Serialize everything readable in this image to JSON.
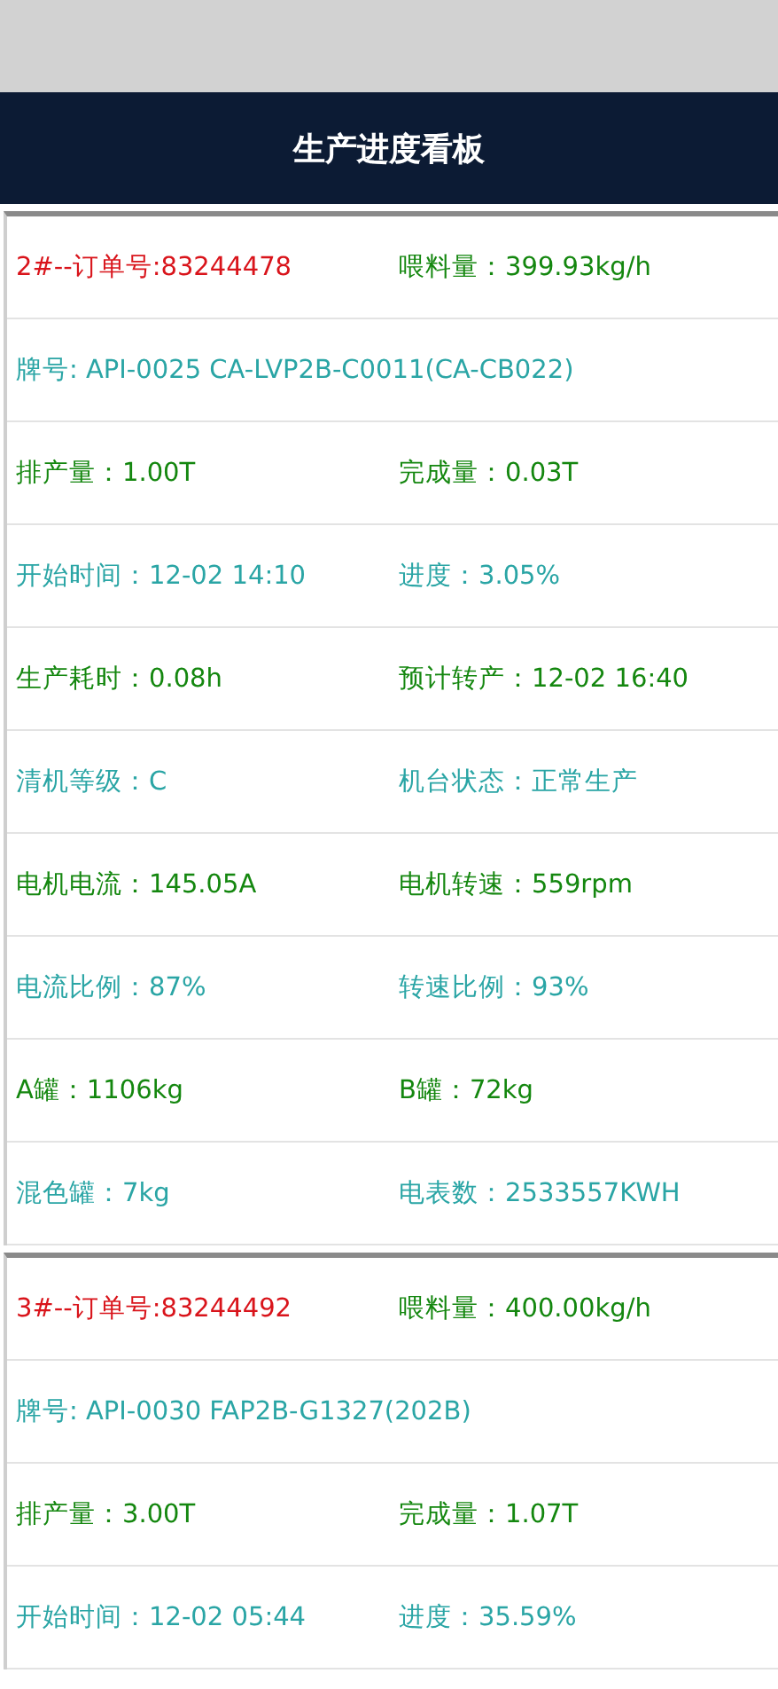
{
  "header": {
    "title": "生产进度看板"
  },
  "cards": [
    {
      "rows": [
        [
          {
            "text": "2#--订单号:83244478",
            "color": "#d9141b"
          },
          {
            "text": "喂料量：399.93kg/h",
            "color": "#14870f"
          }
        ],
        [
          {
            "text": "牌号: API-0025 CA-LVP2B-C0011(CA-CB022)",
            "color": "#2aa5a5"
          }
        ],
        [
          {
            "text": "排产量：1.00T",
            "color": "#14870f"
          },
          {
            "text": "完成量：0.03T",
            "color": "#14870f"
          }
        ],
        [
          {
            "text": "开始时间：12-02 14:10",
            "color": "#2aa5a5"
          },
          {
            "text": "进度：3.05%",
            "color": "#2aa5a5"
          }
        ],
        [
          {
            "text": "生产耗时：0.08h",
            "color": "#14870f"
          },
          {
            "text": "预计转产：12-02 16:40",
            "color": "#14870f"
          }
        ],
        [
          {
            "text": "清机等级：C",
            "color": "#2aa5a5"
          },
          {
            "text": "机台状态：正常生产",
            "color": "#2aa5a5"
          }
        ],
        [
          {
            "text": "电机电流：145.05A",
            "color": "#14870f"
          },
          {
            "text": "电机转速：559rpm",
            "color": "#14870f"
          }
        ],
        [
          {
            "text": "电流比例：87%",
            "color": "#2aa5a5"
          },
          {
            "text": "转速比例：93%",
            "color": "#2aa5a5"
          }
        ],
        [
          {
            "text": "A罐：1106kg",
            "color": "#14870f"
          },
          {
            "text": "B罐：72kg",
            "color": "#14870f"
          }
        ],
        [
          {
            "text": "混色罐：7kg",
            "color": "#2aa5a5"
          },
          {
            "text": "电表数：2533557KWH",
            "color": "#2aa5a5"
          }
        ]
      ]
    },
    {
      "rows": [
        [
          {
            "text": "3#--订单号:83244492",
            "color": "#d9141b"
          },
          {
            "text": "喂料量：400.00kg/h",
            "color": "#14870f"
          }
        ],
        [
          {
            "text": "牌号: API-0030 FAP2B-G1327(202B)",
            "color": "#2aa5a5"
          }
        ],
        [
          {
            "text": "排产量：3.00T",
            "color": "#14870f"
          },
          {
            "text": "完成量：1.07T",
            "color": "#14870f"
          }
        ],
        [
          {
            "text": "开始时间：12-02 05:44",
            "color": "#2aa5a5"
          },
          {
            "text": "进度：35.59%",
            "color": "#2aa5a5"
          }
        ]
      ]
    }
  ]
}
